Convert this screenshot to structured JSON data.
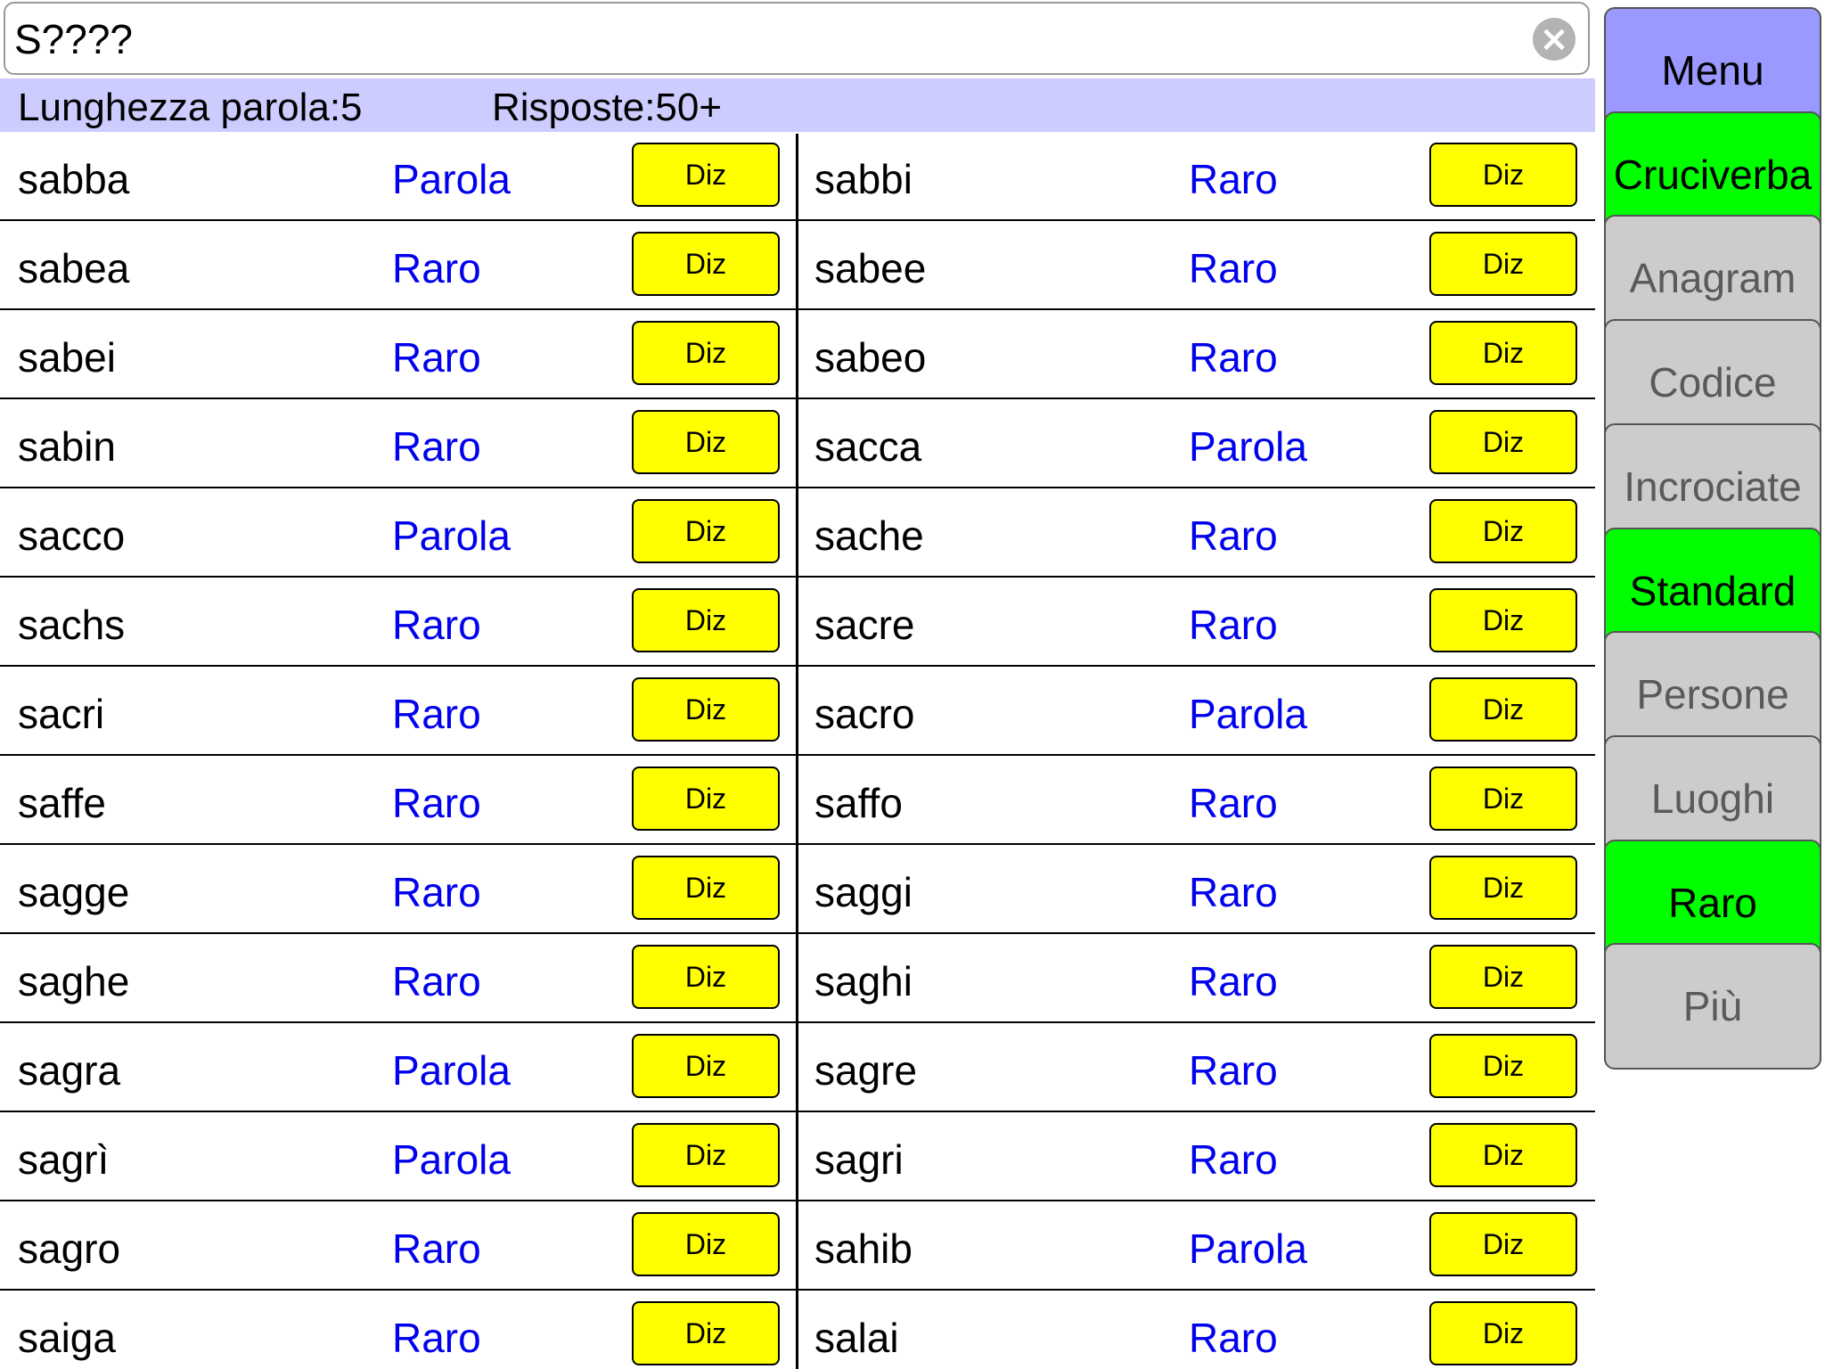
{
  "search": {
    "value": "S????",
    "clear_symbol": "×"
  },
  "info": {
    "length_label": "Lunghezza parola:5",
    "answers_label": "Risposte:50+"
  },
  "colors": {
    "info_bar": "#ccccff",
    "word_kind": "#0000ee",
    "diz_button": "#ffff00",
    "menu_button": "#9999ff",
    "active_button": "#00ff00",
    "inactive_button": "#cccccc"
  },
  "results": {
    "diz_label": "Diz",
    "rows": [
      {
        "left": {
          "word": "sabba",
          "kind": "Parola"
        },
        "right": {
          "word": "sabbi",
          "kind": "Raro"
        }
      },
      {
        "left": {
          "word": "sabea",
          "kind": "Raro"
        },
        "right": {
          "word": "sabee",
          "kind": "Raro"
        }
      },
      {
        "left": {
          "word": "sabei",
          "kind": "Raro"
        },
        "right": {
          "word": "sabeo",
          "kind": "Raro"
        }
      },
      {
        "left": {
          "word": "sabin",
          "kind": "Raro"
        },
        "right": {
          "word": "sacca",
          "kind": "Parola"
        }
      },
      {
        "left": {
          "word": "sacco",
          "kind": "Parola"
        },
        "right": {
          "word": "sache",
          "kind": "Raro"
        }
      },
      {
        "left": {
          "word": "sachs",
          "kind": "Raro"
        },
        "right": {
          "word": "sacre",
          "kind": "Raro"
        }
      },
      {
        "left": {
          "word": "sacri",
          "kind": "Raro"
        },
        "right": {
          "word": "sacro",
          "kind": "Parola"
        }
      },
      {
        "left": {
          "word": "saffe",
          "kind": "Raro"
        },
        "right": {
          "word": "saffo",
          "kind": "Raro"
        }
      },
      {
        "left": {
          "word": "sagge",
          "kind": "Raro"
        },
        "right": {
          "word": "saggi",
          "kind": "Raro"
        }
      },
      {
        "left": {
          "word": "saghe",
          "kind": "Raro"
        },
        "right": {
          "word": "saghi",
          "kind": "Raro"
        }
      },
      {
        "left": {
          "word": "sagra",
          "kind": "Parola"
        },
        "right": {
          "word": "sagre",
          "kind": "Raro"
        }
      },
      {
        "left": {
          "word": "sagrì",
          "kind": "Parola"
        },
        "right": {
          "word": "sagri",
          "kind": "Raro"
        }
      },
      {
        "left": {
          "word": "sagro",
          "kind": "Raro"
        },
        "right": {
          "word": "sahib",
          "kind": "Parola"
        }
      },
      {
        "left": {
          "word": "saiga",
          "kind": "Raro"
        },
        "right": {
          "word": "salai",
          "kind": "Raro"
        }
      }
    ]
  },
  "sidebar": {
    "buttons": [
      {
        "label": "Menu",
        "state": "menu"
      },
      {
        "label": "Cruciverba",
        "state": "on"
      },
      {
        "label": "Anagram",
        "state": "off"
      },
      {
        "label": "Codice",
        "state": "off"
      },
      {
        "label": "Incrociate",
        "state": "off"
      },
      {
        "label": "Standard",
        "state": "on"
      },
      {
        "label": "Persone",
        "state": "off"
      },
      {
        "label": "Luoghi",
        "state": "off"
      },
      {
        "label": "Raro",
        "state": "on"
      },
      {
        "label": "Più",
        "state": "off"
      }
    ]
  }
}
